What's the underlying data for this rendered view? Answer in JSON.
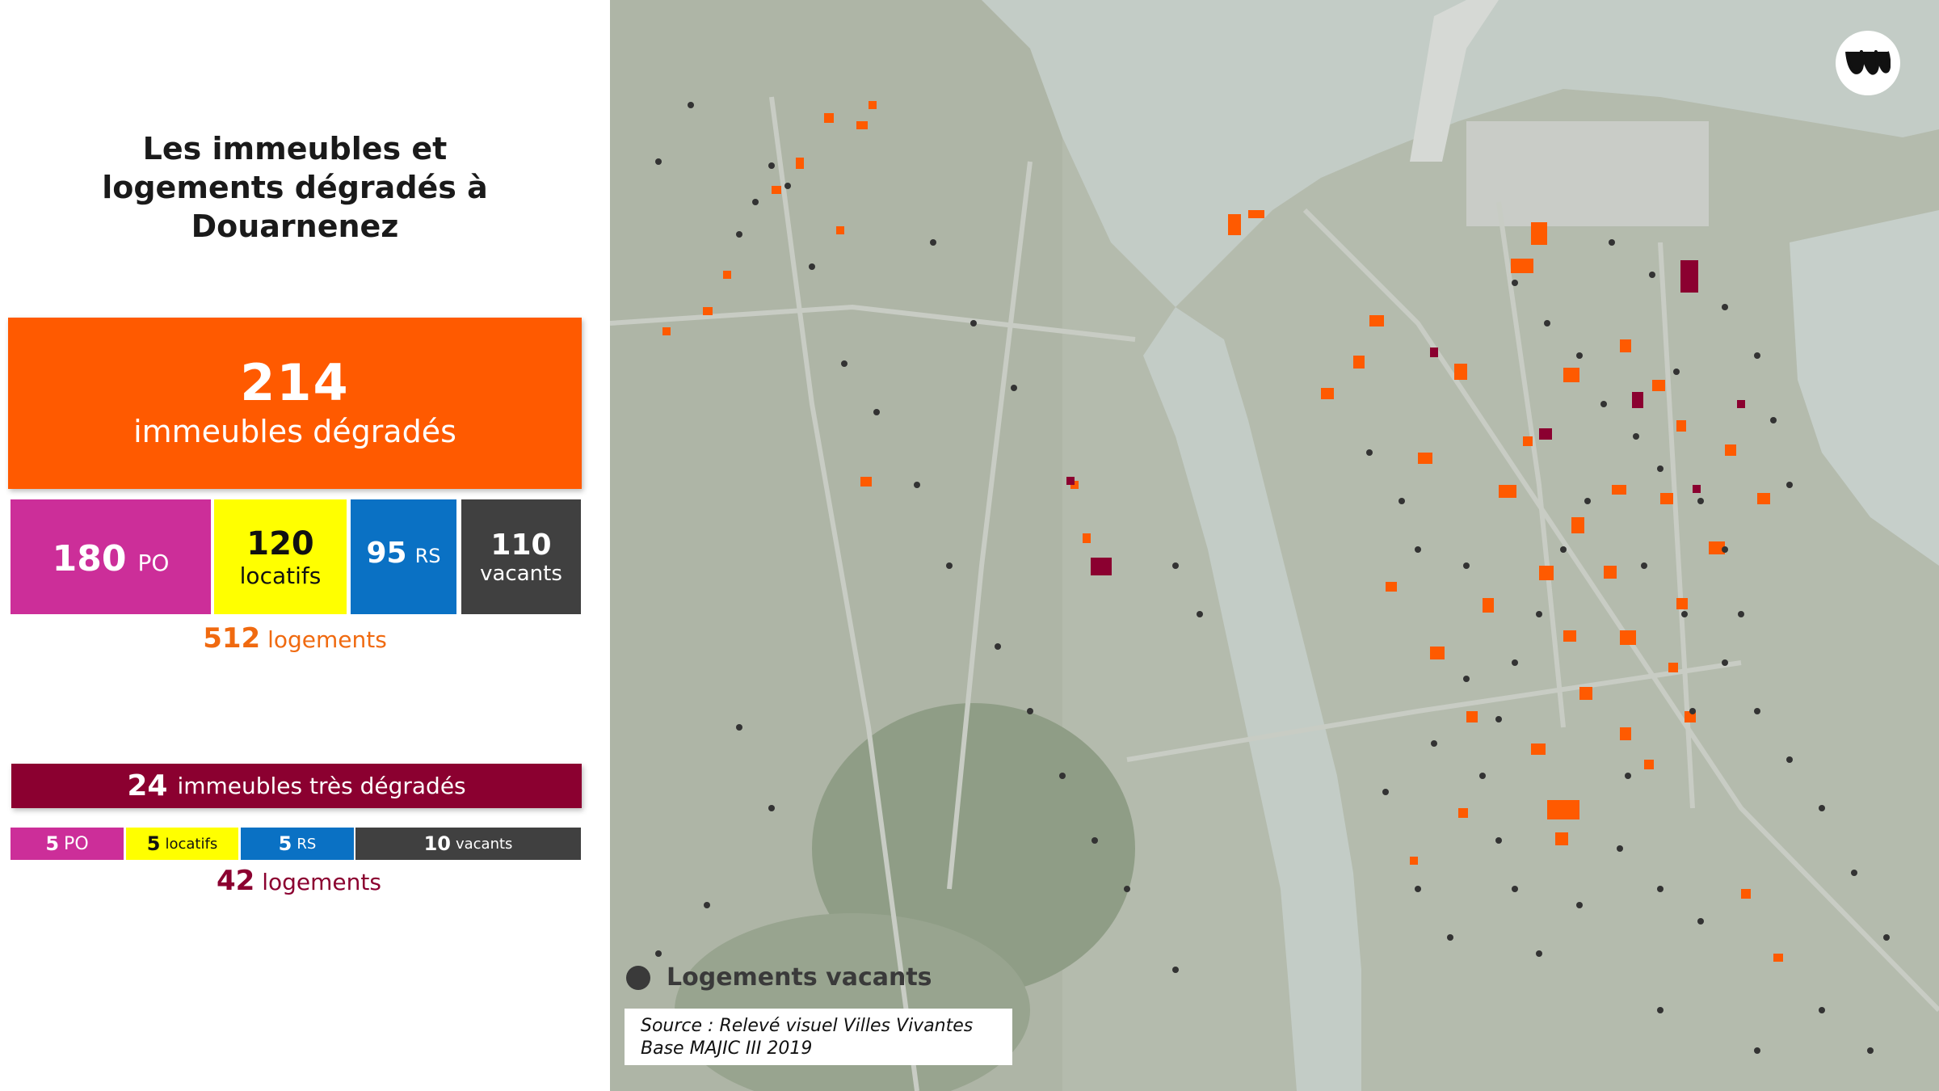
{
  "title": "Les immeubles et logements dégradés à Douarnenez",
  "summary": {
    "count": "214",
    "label": "immeubles dégradés",
    "breakdown": [
      {
        "num": "180",
        "label": "PO"
      },
      {
        "num": "120",
        "label": "locatifs"
      },
      {
        "num": "95",
        "label": "RS"
      },
      {
        "num": "110",
        "label": "vacants"
      }
    ],
    "total_num": "512",
    "total_label": "logements"
  },
  "very_degraded": {
    "count": "24",
    "label": "immeubles très dégradés",
    "breakdown": [
      {
        "num": "5",
        "label": "PO"
      },
      {
        "num": "5",
        "label": "locatifs"
      },
      {
        "num": "5",
        "label": "RS"
      },
      {
        "num": "10",
        "label": "vacants"
      }
    ],
    "total_num": "42",
    "total_label": "logements"
  },
  "legend": {
    "vacant_label": "Logements vacants"
  },
  "source": {
    "line1": "Source : Relevé visuel Villes Vivantes",
    "line2": "Base MAJIC III 2019"
  },
  "colors": {
    "orange": "#ff5a00",
    "po": "#cc2e99",
    "locatifs": "#ffff00",
    "rs": "#0a71c4",
    "vacants": "#404040",
    "very_degraded": "#8b0030"
  },
  "icons": {
    "logo": "villes-vivantes-logo-icon"
  }
}
